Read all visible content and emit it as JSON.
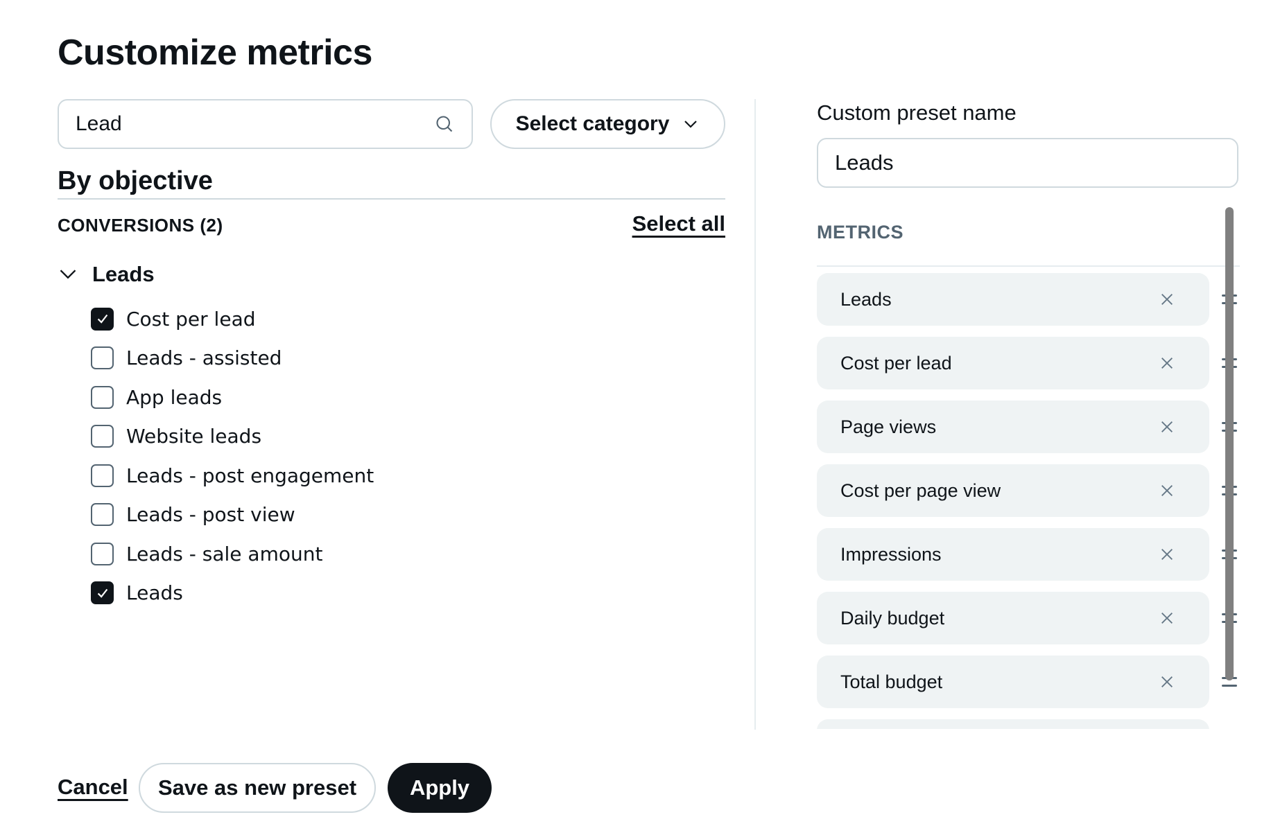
{
  "dialog": {
    "title": "Customize metrics"
  },
  "search": {
    "value": "Lead",
    "icon": "search-icon"
  },
  "category_select": {
    "label": "Select category",
    "icon": "chevron-down-icon"
  },
  "objective": {
    "heading": "By objective",
    "group_label": "CONVERSIONS (2)",
    "select_all_label": "Select all",
    "tree": {
      "label": "Leads",
      "expanded": true,
      "items": [
        {
          "label": "Cost per lead",
          "checked": true
        },
        {
          "label": "Leads - assisted",
          "checked": false
        },
        {
          "label": "App leads",
          "checked": false
        },
        {
          "label": "Website leads",
          "checked": false
        },
        {
          "label": "Leads - post engagement",
          "checked": false
        },
        {
          "label": "Leads - post view",
          "checked": false
        },
        {
          "label": "Leads - sale amount",
          "checked": false
        },
        {
          "label": "Leads",
          "checked": true
        }
      ]
    }
  },
  "preset": {
    "label": "Custom preset name",
    "value": "Leads"
  },
  "metrics": {
    "label": "METRICS",
    "items": [
      {
        "label": "Leads"
      },
      {
        "label": "Cost per lead"
      },
      {
        "label": "Page views"
      },
      {
        "label": "Cost per page view"
      },
      {
        "label": "Impressions"
      },
      {
        "label": "Daily budget"
      },
      {
        "label": "Total budget"
      },
      {
        "label": ""
      }
    ]
  },
  "footer": {
    "cancel_label": "Cancel",
    "save_label": "Save as new preset",
    "apply_label": "Apply"
  },
  "colors": {
    "primary": "#0f1419",
    "secondary_text": "#536471",
    "border": "#cfd9de",
    "chip_bg": "#eff3f4"
  }
}
